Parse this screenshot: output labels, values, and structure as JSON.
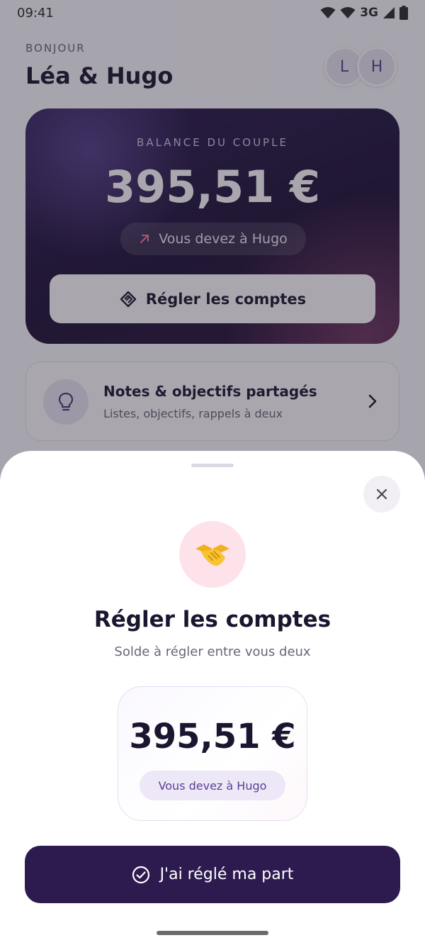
{
  "status_bar": {
    "time": "09:41",
    "network": "3G",
    "icons": [
      "wifi-icon",
      "wifi-icon",
      "signal-icon",
      "battery-icon"
    ]
  },
  "header": {
    "greeting": "BONJOUR",
    "names": "Léa & Hugo",
    "avatars": [
      {
        "initial": "L"
      },
      {
        "initial": "H"
      }
    ]
  },
  "balance_card": {
    "label": "BALANCE DU COUPLE",
    "amount": "395,51 €",
    "status": "Vous devez à Hugo",
    "status_icon": "arrow-up-right-icon",
    "button_label": "Régler les comptes",
    "button_icon": "handshake-outline-icon"
  },
  "notes_card": {
    "title": "Notes & objectifs partagés",
    "subtitle": "Listes, objectifs, rappels à deux",
    "icon": "lightbulb-icon"
  },
  "sheet": {
    "emoji": "🤝",
    "title": "Régler les comptes",
    "subtitle": "Solde à régler entre vous deux",
    "amount": "395,51 €",
    "status": "Vous devez à Hugo",
    "primary_button": "J'ai réglé ma part"
  },
  "colors": {
    "brand_dark": "#2d1b50",
    "accent_purple": "#5a3f93",
    "accent_pink": "#fde2ea"
  }
}
